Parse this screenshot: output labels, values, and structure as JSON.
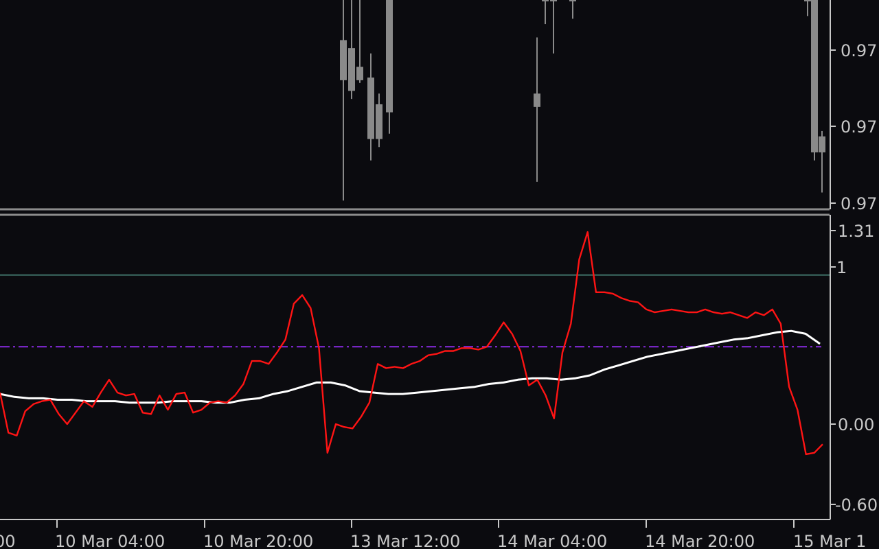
{
  "colors": {
    "background": "#0b0b0f",
    "axis": "#c8c8c8",
    "pane_border": "#8c8c8c",
    "candle": "#8a8a8a",
    "indicator_line": "#ff1414",
    "signal_line": "#ffffff",
    "level_line": "#3c6c64",
    "dashed_level": "#8a2be2"
  },
  "price_axis": {
    "labels": [
      "0.97",
      "0.97",
      "0.97"
    ]
  },
  "indicator_axis": {
    "labels": [
      "1.31",
      "1",
      "0.00",
      "-0.60"
    ]
  },
  "time_axis": {
    "labels": [
      "00",
      "10 Mar 04:00",
      "10 Mar 20:00",
      "13 Mar 12:00",
      "14 Mar 04:00",
      "14 Mar 20:00",
      "15 Mar 1"
    ]
  },
  "chart_data": {
    "type": "line",
    "indicator_scale": {
      "top_value": 1.31,
      "bottom_value": -0.6
    },
    "levels": {
      "solid": 1,
      "dashed": 0.5
    },
    "candles": [
      {
        "open": 0.9715,
        "close": 0.97,
        "high": 0.973,
        "low": 0.9655
      },
      {
        "open": 0.9712,
        "close": 0.9696,
        "high": 0.973,
        "low": 0.9693
      },
      {
        "open": 0.9705,
        "close": 0.97,
        "high": 0.973,
        "low": 0.9699
      },
      {
        "open": 0.9701,
        "close": 0.9678,
        "high": 0.971,
        "low": 0.967
      },
      {
        "open": 0.9691,
        "close": 0.9678,
        "high": 0.9695,
        "low": 0.9675
      },
      {
        "open": 0.973,
        "close": 0.9688,
        "high": 0.973,
        "low": 0.968
      },
      {
        "open": 0.9695,
        "close": 0.969,
        "high": 0.9716,
        "low": 0.9662
      },
      {
        "open": 0.973,
        "close": 0.973,
        "high": 0.973,
        "low": 0.9721
      },
      {
        "open": 0.973,
        "close": 0.973,
        "high": 0.973,
        "low": 0.971
      },
      {
        "open": 0.973,
        "close": 0.973,
        "high": 0.973,
        "low": 0.9723
      },
      {
        "open": 0.973,
        "close": 0.973,
        "high": 0.973,
        "low": 0.9724
      },
      {
        "open": 0.973,
        "close": 0.973,
        "high": 0.973,
        "low": 0.9722
      },
      {
        "open": 0.973,
        "close": 0.9673,
        "high": 0.973,
        "low": 0.967
      },
      {
        "open": 0.9679,
        "close": 0.9673,
        "high": 0.9681,
        "low": 0.9658
      }
    ],
    "indicator_series": [
      0.18,
      -0.1,
      -0.12,
      0.05,
      0.1,
      0.12,
      0.13,
      0.03,
      -0.04,
      0.04,
      0.12,
      0.08,
      0.18,
      0.27,
      0.18,
      0.16,
      0.17,
      0.04,
      0.03,
      0.16,
      0.06,
      0.17,
      0.18,
      0.04,
      0.06,
      0.11,
      0.12,
      0.11,
      0.16,
      0.24,
      0.4,
      0.4,
      0.38,
      0.46,
      0.55,
      0.8,
      0.86,
      0.77,
      0.49,
      -0.24,
      -0.04,
      -0.06,
      -0.07,
      0.01,
      0.11,
      0.38,
      0.35,
      0.36,
      0.35,
      0.38,
      0.4,
      0.44,
      0.45,
      0.47,
      0.47,
      0.49,
      0.49,
      0.48,
      0.5,
      0.58,
      0.67,
      0.59,
      0.47,
      0.23,
      0.27,
      0.16,
      0.0,
      0.46,
      0.66,
      1.11,
      1.3,
      0.88,
      0.88,
      0.87,
      0.84,
      0.82,
      0.81,
      0.76,
      0.74,
      0.75,
      0.76,
      0.75,
      0.74,
      0.74,
      0.76,
      0.74,
      0.73,
      0.74,
      0.72,
      0.7,
      0.74,
      0.72,
      0.76,
      0.66,
      0.22,
      0.06,
      -0.25,
      -0.24,
      -0.18
    ],
    "signal_series": [
      0.17,
      0.15,
      0.14,
      0.14,
      0.13,
      0.13,
      0.12,
      0.12,
      0.12,
      0.11,
      0.11,
      0.11,
      0.12,
      0.12,
      0.12,
      0.11,
      0.11,
      0.13,
      0.14,
      0.17,
      0.19,
      0.22,
      0.25,
      0.25,
      0.23,
      0.19,
      0.18,
      0.17,
      0.17,
      0.18,
      0.19,
      0.2,
      0.21,
      0.22,
      0.24,
      0.25,
      0.27,
      0.28,
      0.28,
      0.27,
      0.28,
      0.3,
      0.34,
      0.37,
      0.4,
      0.43,
      0.45,
      0.47,
      0.49,
      0.51,
      0.53,
      0.55,
      0.56,
      0.58,
      0.6,
      0.61,
      0.59,
      0.52
    ]
  }
}
